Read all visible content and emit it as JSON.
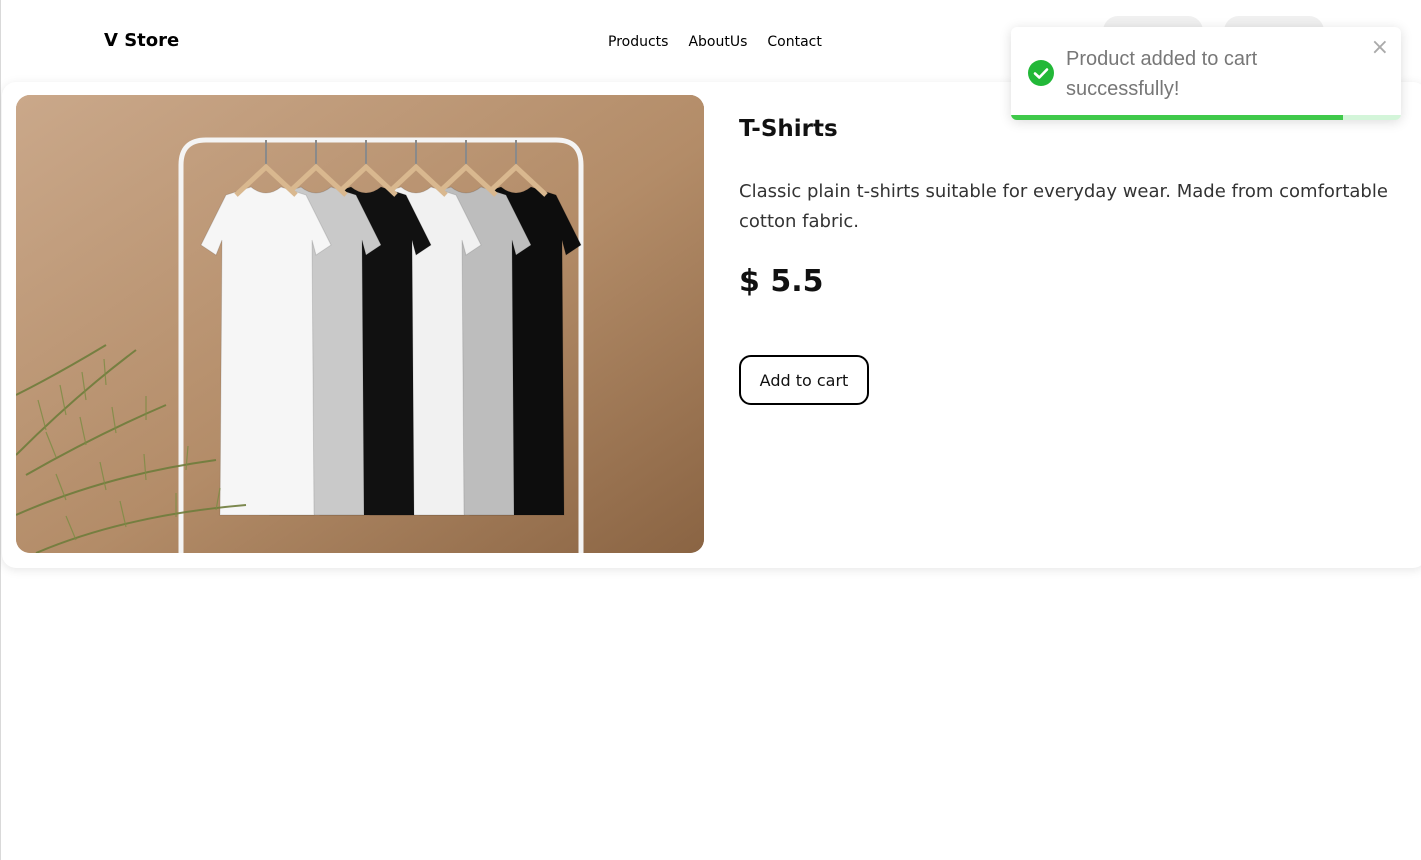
{
  "navbar": {
    "brand": "V Store",
    "links": [
      "Products",
      "AboutUs",
      "Contact"
    ]
  },
  "product": {
    "title": "T-Shirts",
    "description": "Classic plain t-shirts suitable for everyday wear. Made from comfortable cotton fabric.",
    "price": "$ 5.5",
    "add_to_cart_label": "Add to cart",
    "shirt_colors": [
      "#f6f6f6",
      "#c9c9c9",
      "#111111",
      "#f1f1f1",
      "#bdbdbd",
      "#0d0d0d"
    ]
  },
  "toast": {
    "message": "Product added to cart successfully!",
    "close_icon": "×",
    "icon": "check-circle-icon",
    "progress_fraction": 0.85,
    "success_color": "#22b838"
  }
}
